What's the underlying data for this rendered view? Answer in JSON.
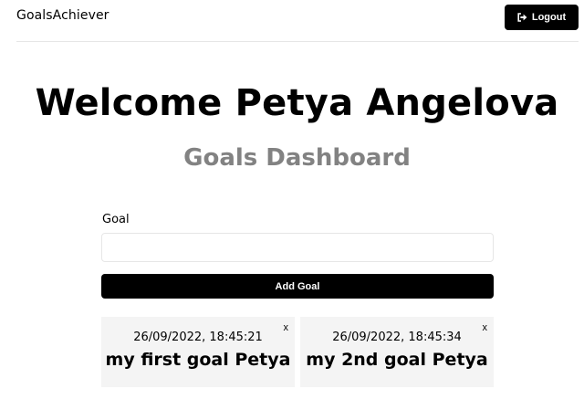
{
  "header": {
    "brand": "GoalsAchiever",
    "logout_label": "Logout",
    "logout_icon": "sign-out-icon"
  },
  "main": {
    "welcome": "Welcome Petya Angelova",
    "title": "Goals Dashboard"
  },
  "form": {
    "goal_label": "Goal",
    "goal_value": "",
    "add_button": "Add Goal"
  },
  "goals": [
    {
      "date": "26/09/2022, 18:45:21",
      "text": "my first goal Petya",
      "close": "x"
    },
    {
      "date": "26/09/2022, 18:45:34",
      "text": "my 2nd goal Petya",
      "close": "x"
    }
  ],
  "colors": {
    "button_bg": "#000000",
    "subtitle": "#828282",
    "card_bg": "#f4f4f4"
  }
}
